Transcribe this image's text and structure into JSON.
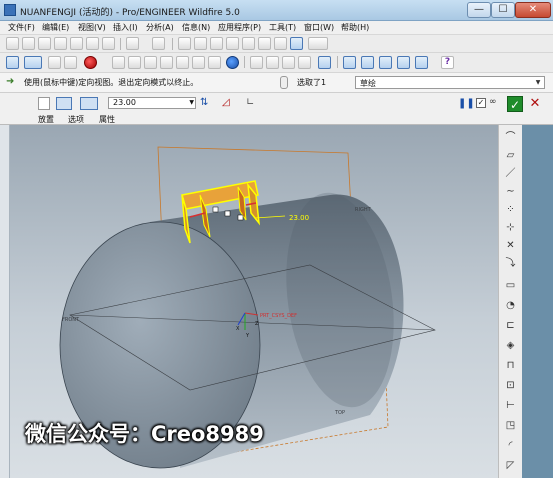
{
  "window": {
    "title": "NUANFENGJI (活动的) - Pro/ENGINEER Wildfire 5.0",
    "min_glyph": "—",
    "max_glyph": "☐",
    "close_glyph": "✕"
  },
  "menu": [
    {
      "label": "文件(F)"
    },
    {
      "label": "编辑(E)"
    },
    {
      "label": "视图(V)"
    },
    {
      "label": "插入(I)"
    },
    {
      "label": "分析(A)"
    },
    {
      "label": "信息(N)"
    },
    {
      "label": "应用程序(P)"
    },
    {
      "label": "工具(T)"
    },
    {
      "label": "窗口(W)"
    },
    {
      "label": "帮助(H)"
    }
  ],
  "message": {
    "text": "使用(鼠标中键)定向视图。退出定向模式以终止。",
    "selection_text": "选取了1",
    "filter_value": "草绘"
  },
  "dashboard": {
    "depth_value": "23.00",
    "tabs": [
      "放置",
      "选项",
      "属性"
    ]
  },
  "graphics": {
    "dim_label": "23.00",
    "datum_labels": [
      "RIGHT",
      "FRONT",
      "TOP",
      "PRT_CSYS_DEF"
    ],
    "axis_labels": [
      "X",
      "Y",
      "Z"
    ]
  },
  "watermark": "微信公众号：Creo8989",
  "colors": {
    "datum_plane": "#c8782a",
    "highlight": "#ffff00",
    "cylinder": "#7d8a96",
    "ok_green": "#1f8c2b"
  }
}
